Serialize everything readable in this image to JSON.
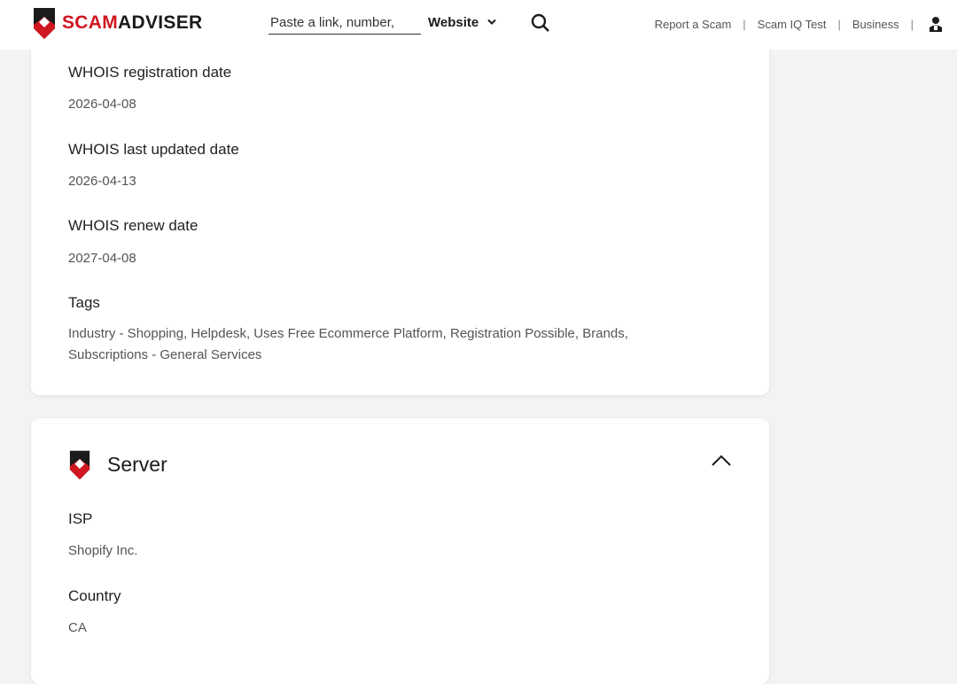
{
  "header": {
    "logo": {
      "part1": "SCAM",
      "part2": "ADVISER",
      "icon": "shield-logo-icon"
    },
    "search": {
      "placeholder": "Paste a link, number,",
      "value": ""
    },
    "type_select": {
      "selected": "Website",
      "icon": "chevron-down-icon"
    },
    "search_icon": "search-icon",
    "nav": {
      "report": "Report a Scam",
      "sep": "|",
      "iq": "Scam IQ Test",
      "business": "Business",
      "user_icon": "user-icon"
    }
  },
  "whois_card": {
    "fields": [
      {
        "label": "WHOIS registration date",
        "value": "2026-04-08"
      },
      {
        "label": "WHOIS last updated date",
        "value": "2026-04-13"
      },
      {
        "label": "WHOIS renew date",
        "value": "2027-04-08"
      }
    ],
    "tags": {
      "label": "Tags",
      "line1": "Industry - Shopping, Helpdesk, Uses Free Ecommerce Platform, Registration Possible, Brands,",
      "line2": "Subscriptions - General Services"
    }
  },
  "server_card": {
    "title": "Server",
    "title_icon": "shield-logo-icon",
    "collapse_icon": "chevron-up-icon",
    "fields": [
      {
        "label": "ISP",
        "value": "Shopify Inc."
      },
      {
        "label": "Country",
        "value": "CA"
      }
    ]
  },
  "colors": {
    "brand_red": "#d0161f",
    "background": "#f3f3f3",
    "card": "#ffffff"
  }
}
